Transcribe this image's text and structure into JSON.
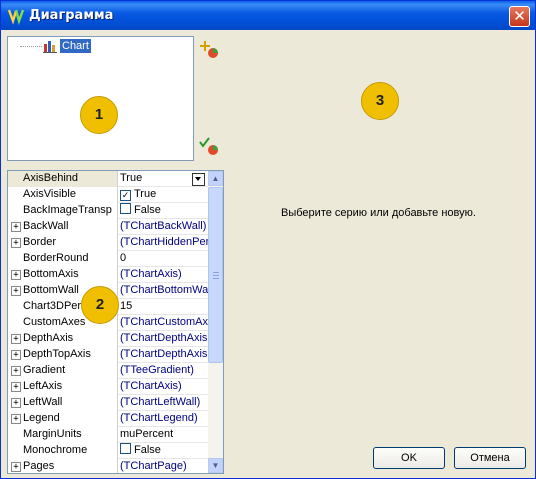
{
  "window": {
    "title": "Диаграмма",
    "close_glyph": "✕"
  },
  "tree": {
    "items": [
      {
        "label": "Chart",
        "icon": "chart-series-icon"
      }
    ]
  },
  "toolbar": {
    "add_icon": "add-series-icon",
    "check_icon": "check-series-icon"
  },
  "properties": [
    {
      "name": "AxisBehind",
      "value": "True",
      "expandable": false,
      "type": "dropdown"
    },
    {
      "name": "AxisVisible",
      "value": "True",
      "expandable": false,
      "type": "checkbox",
      "checked": true
    },
    {
      "name": "BackImageTransp",
      "value": "False",
      "expandable": false,
      "type": "checkbox",
      "checked": false
    },
    {
      "name": "BackWall",
      "value": "(TChartBackWall)",
      "expandable": true,
      "type": "object"
    },
    {
      "name": "Border",
      "value": "(TChartHiddenPen",
      "expandable": true,
      "type": "object"
    },
    {
      "name": "BorderRound",
      "value": "0",
      "expandable": false,
      "type": "text"
    },
    {
      "name": "BottomAxis",
      "value": "(TChartAxis)",
      "expandable": true,
      "type": "object"
    },
    {
      "name": "BottomWall",
      "value": "(TChartBottomWa",
      "expandable": true,
      "type": "object"
    },
    {
      "name": "Chart3DPercent",
      "value": "15",
      "expandable": false,
      "type": "text"
    },
    {
      "name": "CustomAxes",
      "value": "(TChartCustomAx",
      "expandable": false,
      "type": "object"
    },
    {
      "name": "DepthAxis",
      "value": "(TChartDepthAxis",
      "expandable": true,
      "type": "object"
    },
    {
      "name": "DepthTopAxis",
      "value": "(TChartDepthAxis",
      "expandable": true,
      "type": "object"
    },
    {
      "name": "Gradient",
      "value": "(TTeeGradient)",
      "expandable": true,
      "type": "object"
    },
    {
      "name": "LeftAxis",
      "value": "(TChartAxis)",
      "expandable": true,
      "type": "object"
    },
    {
      "name": "LeftWall",
      "value": "(TChartLeftWall)",
      "expandable": true,
      "type": "object"
    },
    {
      "name": "Legend",
      "value": "(TChartLegend)",
      "expandable": true,
      "type": "object"
    },
    {
      "name": "MarginUnits",
      "value": "muPercent",
      "expandable": false,
      "type": "text"
    },
    {
      "name": "Monochrome",
      "value": "False",
      "expandable": false,
      "type": "checkbox",
      "checked": false
    },
    {
      "name": "Pages",
      "value": "(TChartPage)",
      "expandable": true,
      "type": "object"
    }
  ],
  "main": {
    "message": "Выберите серию или добавьте новую."
  },
  "badges": [
    "1",
    "2",
    "3"
  ],
  "buttons": {
    "ok": "OK",
    "cancel": "Отмена"
  },
  "colors": {
    "titlebar": "#0a5fe8",
    "selection": "#316ac5",
    "badge": "#f0c000",
    "link": "#000080"
  }
}
